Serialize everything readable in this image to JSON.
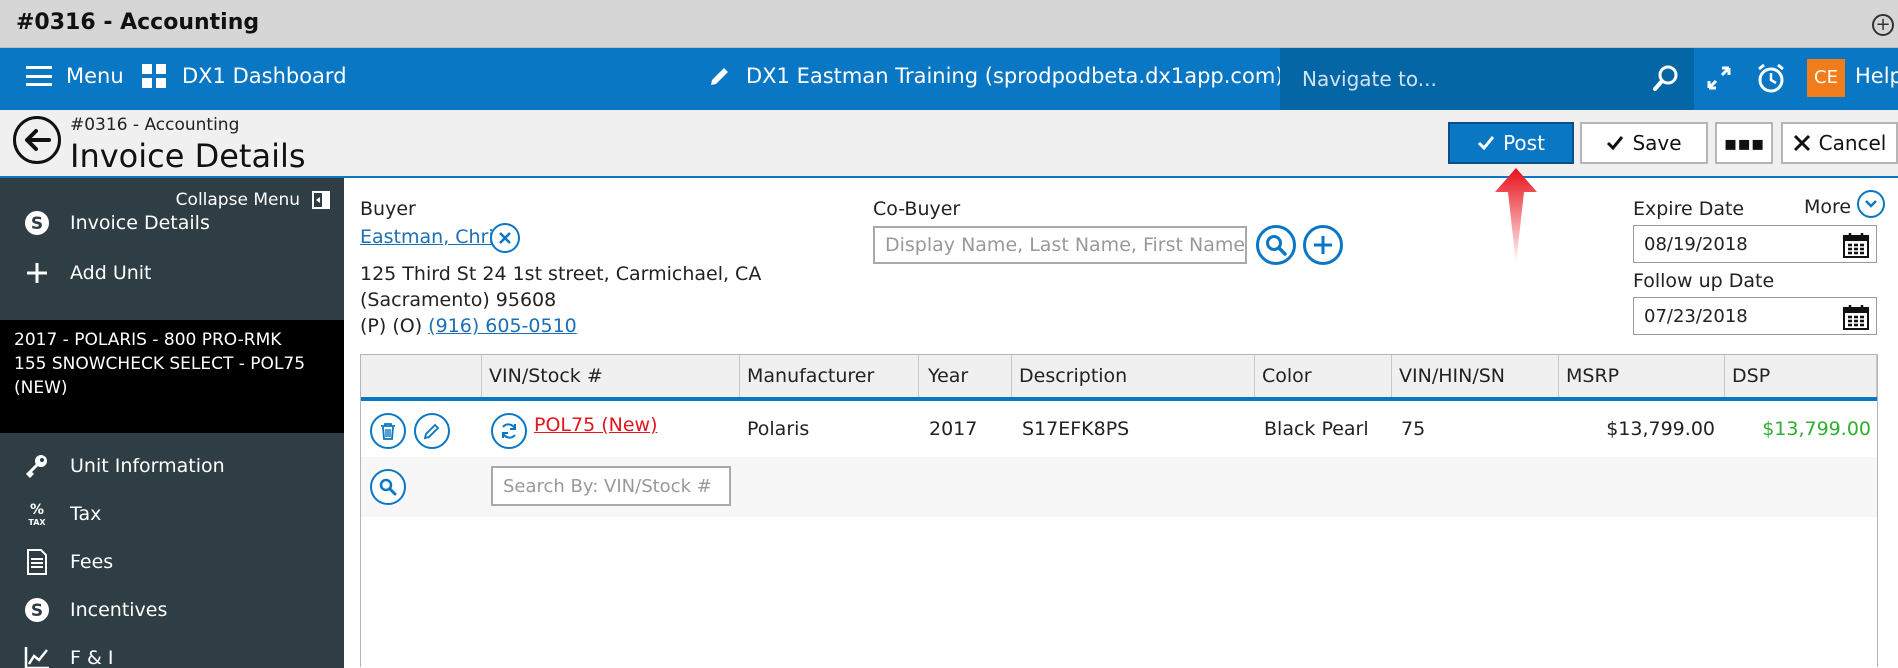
{
  "window": {
    "title": "#0316 - Accounting",
    "plus_glyph": "+"
  },
  "appbar": {
    "menu_label": "Menu",
    "dashboard_label": "DX1 Dashboard",
    "env_label": "DX1 Eastman Training (sprodpodbeta.dx1app.com)",
    "navigate_placeholder": "Navigate to...",
    "avatar_initials": "CE",
    "help_label": "Help"
  },
  "header": {
    "breadcrumb": "#0316 - Accounting",
    "title": "Invoice Details",
    "post_label": "Post",
    "save_label": "Save",
    "more_label": "▪▪▪",
    "cancel_label": "Cancel"
  },
  "sidebar": {
    "collapse_label": "Collapse Menu",
    "items_top": [
      {
        "label": "Invoice Details",
        "icon": "dollar-circle-icon"
      },
      {
        "label": "Add Unit",
        "icon": "plus-icon"
      }
    ],
    "unit_lines": [
      "2017 - POLARIS - 800 PRO-RMK",
      "155 SNOWCHECK SELECT - POL75",
      "(NEW)"
    ],
    "items_bottom": [
      {
        "label": "Unit Information",
        "icon": "key-icon"
      },
      {
        "label": "Tax",
        "icon": "percent-tax-icon"
      },
      {
        "label": "Fees",
        "icon": "document-icon"
      },
      {
        "label": "Incentives",
        "icon": "dollar-circle-icon"
      },
      {
        "label": "F & I",
        "icon": "chart-icon"
      }
    ]
  },
  "buyer": {
    "label": "Buyer",
    "name": "Eastman, Chris",
    "address_line1": "125 Third St 24 1st street, Carmichael, CA",
    "address_line2": "(Sacramento) 95608",
    "phone_prefix": "(P) (O)",
    "phone": "(916) 605-0510"
  },
  "cobuyer": {
    "label": "Co-Buyer",
    "placeholder": "Display Name, Last Name, First Name or"
  },
  "dates": {
    "more_label": "More",
    "expire_label": "Expire Date",
    "expire_value": "08/19/2018",
    "followup_label": "Follow up Date",
    "followup_value": "07/23/2018"
  },
  "table": {
    "columns": [
      "",
      "VIN/Stock #",
      "Manufacturer",
      "Year",
      "Description",
      "Color",
      "VIN/HIN/SN",
      "MSRP",
      "DSP"
    ],
    "row": {
      "stock": "POL75 (New)",
      "manufacturer": "Polaris",
      "year": "2017",
      "description": "S17EFK8PS",
      "color": "Black Pearl",
      "vin": "75",
      "msrp": "$13,799.00",
      "dsp": "$13,799.00"
    },
    "search_placeholder": "Search By: VIN/Stock #"
  },
  "colors": {
    "brand_blue": "#0a77c4",
    "sidebar": "#2e3e44",
    "avatar": "#f07c1b",
    "alert_red": "#e3151f",
    "price_green": "#2db02d"
  }
}
